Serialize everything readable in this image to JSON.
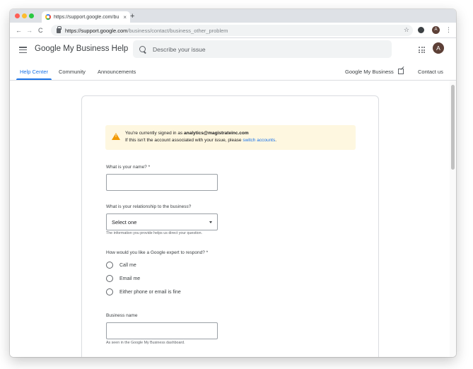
{
  "browser": {
    "tab_title": "https://support.google.com/bu",
    "tab_close": "×",
    "new_tab": "+",
    "nav": {
      "back": "←",
      "forward": "→",
      "reload": "C"
    },
    "url_host": "https://support.google.com",
    "url_path": "/business/contact/business_other_problem",
    "star": "☆",
    "profile_initial": "A",
    "menu": "⋮"
  },
  "header": {
    "site_title": "Google My Business Help",
    "search_placeholder": "Describe your issue",
    "avatar_initial": "A"
  },
  "nav_tabs": {
    "help_center": "Help Center",
    "community": "Community",
    "announcements": "Announcements",
    "gmb_link": "Google My Business",
    "contact_us": "Contact us"
  },
  "notice": {
    "signed_in_prefix": "You're currently signed in as ",
    "email": "analytics@magistrateinc.com",
    "line2_prefix": "If this isn't the account associated with your issue, please ",
    "switch_link": "switch accounts",
    "line2_suffix": ".",
    "icon_glyph": "!"
  },
  "form": {
    "name_label": "What is your name? *",
    "name_value": "",
    "relationship_label": "What is your relationship to the business?",
    "relationship_selected": "Select one",
    "relationship_helper": "The information you provide helps us direct your question.",
    "respond_label": "How would you like a Google expert to respond? *",
    "respond_options": [
      "Call me",
      "Email me",
      "Either phone or email is fine"
    ],
    "business_name_label": "Business name",
    "business_name_value": "",
    "business_name_helper": "As seen in the Google My Business dashboard."
  },
  "colors": {
    "accent": "#1a73e8",
    "warning": "#f29900",
    "notice_bg": "#fef7e0"
  }
}
